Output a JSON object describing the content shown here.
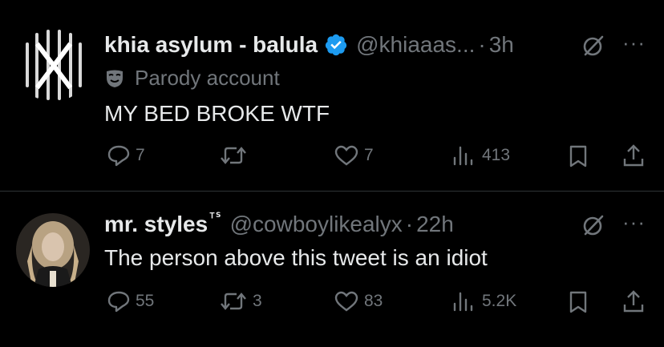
{
  "tweets": [
    {
      "name": "khia asylum - balula",
      "handle": "@khiaaas...",
      "separator": "·",
      "time": "3h",
      "parody_label": "Parody account",
      "text": "MY BED BROKE WTF",
      "replies": "7",
      "reposts": "",
      "likes": "7",
      "views": "413",
      "verified_color": "#1d9bf0"
    },
    {
      "name": "mr. styles",
      "name_suffix": "ᵀᔆ",
      "handle": "@cowboylikealyx",
      "separator": "·",
      "time": "22h",
      "text": "The person above this tweet is an idiot",
      "replies": "55",
      "reposts": "3",
      "likes": "83",
      "views": "5.2K"
    }
  ],
  "more_glyph": "···",
  "icons": {
    "reply": "reply-icon",
    "repost": "repost-icon",
    "like": "like-icon",
    "views": "views-icon",
    "bookmark": "bookmark-icon",
    "share": "share-icon",
    "grok": "grok-icon",
    "more": "more-icon"
  },
  "colors": {
    "background": "#000000",
    "text": "#e7e9ea",
    "muted": "#71767b",
    "divider": "#2f3336",
    "verified": "#1d9bf0"
  }
}
